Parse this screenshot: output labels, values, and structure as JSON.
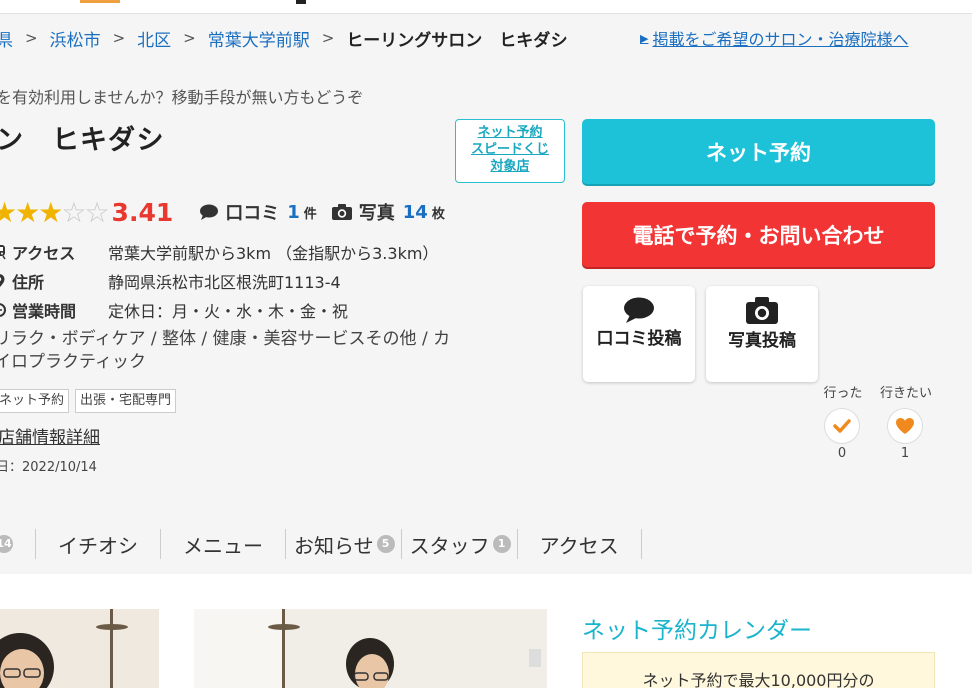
{
  "breadcrumb": {
    "items": [
      "県",
      "浜松市",
      "北区",
      "常葉大学前駅"
    ],
    "current": "ヒーリングサロン　ヒキダシ",
    "separator": ">"
  },
  "publish_link": "掲載をご希望のサロン・治療院様へ",
  "catch_copy": "を有効利用しませんか？移動手段が無い方もどうぞ",
  "salon_name": "ン　ヒキダシ",
  "speed_badge": {
    "line1": "ネット予約",
    "line2": "スピードくじ",
    "line3": "対象店"
  },
  "rating": {
    "score": "3.41",
    "stars_filled": 3,
    "stars_total": 5,
    "review_label": "口コミ",
    "review_count": "1",
    "review_unit": "件",
    "photo_label": "写真",
    "photo_count": "14",
    "photo_unit": "枚"
  },
  "info": {
    "access_label": "アクセス",
    "access_value": "常葉大学前駅から3km （金指駅から3.3km）",
    "address_label": "住所",
    "address_value": "静岡県浜松市北区根洗町1113-4",
    "hours_label": "営業時間",
    "hours_value": "定休日：月・火・水・木・金・祝"
  },
  "genres": "リラク・ボディケア /  整体 /  健康・美容サービスその他 /  カイロプラクティック",
  "tags": [
    "ネット予約",
    "出張・宅配専門"
  ],
  "detail_link": "店舗情報詳細",
  "update_date": "日：2022/10/14",
  "buttons": {
    "net_reserve": "ネット予約",
    "tel_reserve": "電話で予約・お問い合わせ",
    "review_post": "口コミ投稿",
    "photo_post": "写真投稿"
  },
  "visit": {
    "went_label": "行った",
    "want_label": "行きたい",
    "went_count": "0",
    "want_count": "1"
  },
  "tabs": [
    {
      "label": "",
      "badge": "14"
    },
    {
      "label": "イチオシ",
      "badge": ""
    },
    {
      "label": "メニュー",
      "badge": ""
    },
    {
      "label": "お知らせ",
      "badge": "5"
    },
    {
      "label": "スタッフ",
      "badge": "1"
    },
    {
      "label": "アクセス",
      "badge": ""
    }
  ],
  "calendar": {
    "title": "ネット予約カレンダー",
    "notice": "ネット予約で最大10,000円分の"
  },
  "colors": {
    "accent_cyan": "#1ec2d8",
    "accent_red": "#f23434",
    "link_blue": "#1a6fc0",
    "star": "#f0b400",
    "heart": "#f08a1e"
  }
}
